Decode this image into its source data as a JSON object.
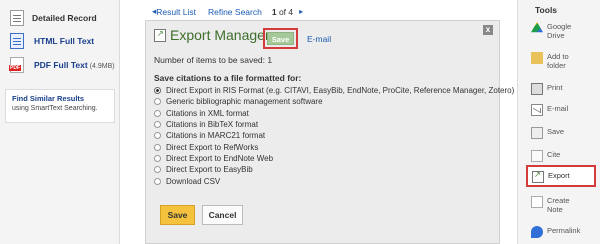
{
  "left": {
    "detailed_record": "Detailed Record",
    "html_full_text": "HTML Full Text",
    "pdf_full_text": "PDF Full Text",
    "pdf_size": "(4.9MB)",
    "pdf_badge": "PDF",
    "similar_title": "Find Similar Results",
    "similar_sub": "using SmartText Searching."
  },
  "nav": {
    "result_list": "Result List",
    "refine_search": "Refine Search",
    "page_prefix": "1",
    "page_of": "of 4",
    "prev_arrow": "◂",
    "next_arrow": "▸"
  },
  "modal": {
    "title": "Export Manager",
    "save_top": "Save",
    "email": "E-mail",
    "count_label": "Number of items to be saved:",
    "count_value": "1",
    "format_heading": "Save citations to a file formatted for:",
    "options": [
      {
        "label": "Direct Export in RIS Format (e.g. CITAVI, EasyBib, EndNote, ProCite, Reference Manager, Zotero)",
        "selected": true
      },
      {
        "label": "Generic bibliographic management software",
        "selected": false
      },
      {
        "label": "Citations in XML format",
        "selected": false
      },
      {
        "label": "Citations in BibTeX format",
        "selected": false
      },
      {
        "label": "Citations in MARC21 format",
        "selected": false
      },
      {
        "label": "Direct Export to RefWorks",
        "selected": false
      },
      {
        "label": "Direct Export to EndNote Web",
        "selected": false
      },
      {
        "label": "Direct Export to EasyBib",
        "selected": false
      },
      {
        "label": "Download CSV",
        "selected": false
      }
    ],
    "save_button": "Save",
    "cancel_button": "Cancel",
    "close": "x"
  },
  "tools": {
    "title": "Tools",
    "items": [
      {
        "label": "Google Drive",
        "icon": "google-drive-icon"
      },
      {
        "label": "Add to folder",
        "icon": "folder-icon"
      },
      {
        "label": "Print",
        "icon": "print-icon"
      },
      {
        "label": "E-mail",
        "icon": "email-icon"
      },
      {
        "label": "Save",
        "icon": "save-icon"
      },
      {
        "label": "Cite",
        "icon": "cite-icon"
      },
      {
        "label": "Export",
        "icon": "export-icon"
      },
      {
        "label": "Create Note",
        "icon": "note-icon"
      },
      {
        "label": "Permalink",
        "icon": "permalink-icon"
      }
    ]
  },
  "colors": {
    "highlight": "#d43c3c",
    "title_green": "#3d6e2a",
    "link_blue": "#1a5bb5",
    "save_yellow": "#f5c23e"
  }
}
